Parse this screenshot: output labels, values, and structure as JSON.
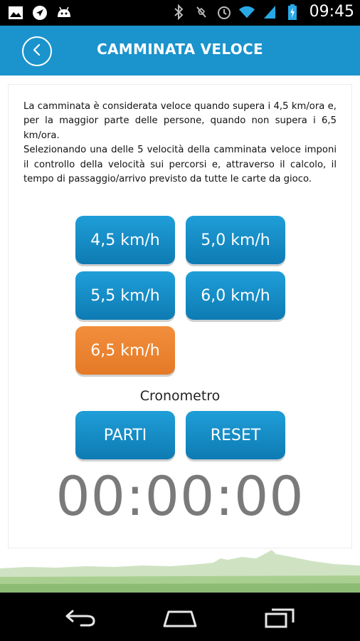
{
  "status_bar": {
    "time": "09:45",
    "left_icons": [
      "image-icon",
      "navigation-icon",
      "android-icon"
    ],
    "right_icons": [
      "bluetooth-icon",
      "signal-off-icon",
      "alarm-icon",
      "wifi-icon",
      "cell-signal-icon",
      "battery-icon"
    ]
  },
  "app_bar": {
    "title": "CAMMINATA VELOCE",
    "back_icon": "chevron-left-icon"
  },
  "description": {
    "text": "La camminata è considerata veloce quando supera i 4,5 km/ora e, per la maggior parte delle persone, quando non supera i 6,5 km/ora.\nSelezionando una delle 5 velocità della camminata veloce imponi il controllo della velocità sui percorsi e, attraverso il calcolo, il tempo di passaggio/arrivo previsto da tutte le carte da gioco."
  },
  "speeds": [
    {
      "label": "4,5 km/h",
      "selected": false
    },
    {
      "label": "5,0 km/h",
      "selected": false
    },
    {
      "label": "5,5 km/h",
      "selected": false
    },
    {
      "label": "6,0 km/h",
      "selected": false
    },
    {
      "label": "6,5 km/h",
      "selected": true
    }
  ],
  "stopwatch": {
    "label": "Cronometro",
    "start_label": "PARTI",
    "reset_label": "RESET",
    "display": "00:00:00"
  },
  "colors": {
    "primary": "#1b93cc",
    "selected": "#ee8532",
    "timer_text": "#7a7a7a"
  },
  "nav_bar": {
    "icons": [
      "back-icon",
      "home-icon",
      "recents-icon"
    ]
  }
}
